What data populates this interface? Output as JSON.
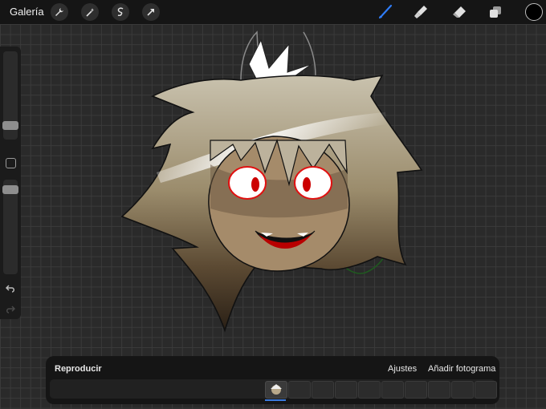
{
  "topbar": {
    "gallery_label": "Galería",
    "tools_left": [
      "wrench-icon",
      "magic-wand-icon",
      "selection-icon",
      "transform-arrow-icon"
    ],
    "tools_right": [
      "brush-icon",
      "smudge-icon",
      "eraser-icon",
      "layers-icon"
    ],
    "active_color": "#000000",
    "accent_color": "#2f7cf6"
  },
  "sidebar": {
    "brush_size_level": 0.81,
    "opacity_level": 0.12
  },
  "timeline": {
    "play_label": "Reproducir",
    "settings_label": "Ajustes",
    "add_frame_label": "Añadir fotograma",
    "active_frame_index": 0,
    "frame_count": 10
  }
}
